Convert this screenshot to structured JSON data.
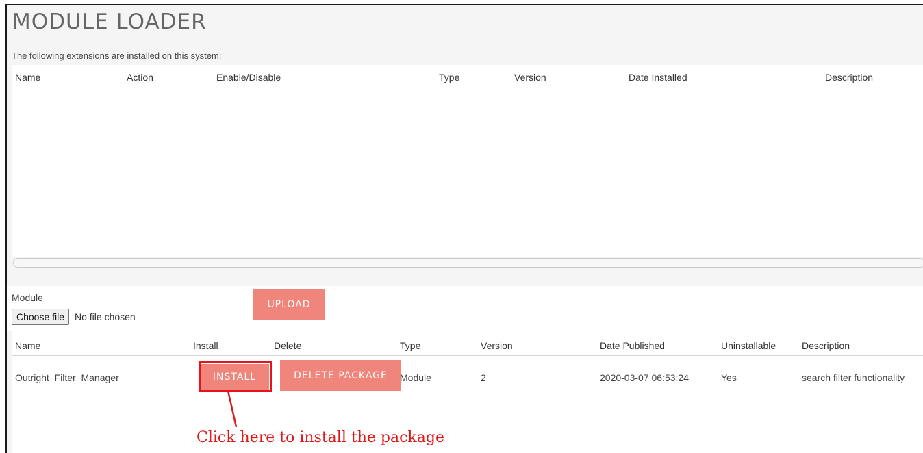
{
  "page": {
    "title": "MODULE LOADER",
    "intro": "The following extensions are installed on this system:"
  },
  "installed_table": {
    "columns": [
      "Name",
      "Action",
      "Enable/Disable",
      "Type",
      "Version",
      "Date Installed",
      "Description"
    ],
    "rows": []
  },
  "upload": {
    "module_label": "Module",
    "choose_file_label": "Choose file",
    "file_status": "No file chosen",
    "upload_label": "UPLOAD"
  },
  "package_table": {
    "columns": [
      "Name",
      "Install",
      "Delete",
      "Type",
      "Version",
      "Date Published",
      "Uninstallable",
      "Description"
    ],
    "rows": [
      {
        "name": "Outright_Filter_Manager",
        "install_label": "INSTALL",
        "delete_label": "DELETE PACKAGE",
        "type": "Module",
        "version": "2",
        "date_published": "2020-03-07 06:53:24",
        "uninstallable": "Yes",
        "description": "search filter functionality"
      }
    ]
  },
  "annotation": {
    "text": "Click here to install the package",
    "color": "#e01818"
  },
  "colors": {
    "button_bg": "#f0857c",
    "highlight": "#e8121b"
  }
}
